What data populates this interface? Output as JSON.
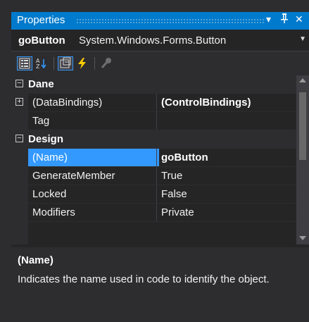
{
  "window": {
    "title": "Properties",
    "controls": {
      "dropdown": "▾",
      "pin": "ᵻ",
      "close": "✕"
    }
  },
  "object_selector": {
    "name": "goButton",
    "type": "System.Windows.Forms.Button"
  },
  "toolbar": {
    "buttons": [
      {
        "icon": "categorized-icon",
        "active": true
      },
      {
        "icon": "alphabetical-icon",
        "active": false
      },
      {
        "icon": "properties-icon",
        "active": true
      },
      {
        "icon": "events-icon",
        "active": false
      },
      {
        "icon": "property-pages-icon",
        "active": false
      }
    ]
  },
  "grid": {
    "categories": [
      {
        "name": "Dane",
        "expanded": true,
        "symbol": "−",
        "properties": [
          {
            "name": "(DataBindings)",
            "value": "(ControlBindings)",
            "expandable": true,
            "symbol": "+",
            "bold": true
          },
          {
            "name": "Tag",
            "value": ""
          }
        ]
      },
      {
        "name": "Design",
        "expanded": true,
        "symbol": "−",
        "properties": [
          {
            "name": "(Name)",
            "value": "goButton",
            "selected": true,
            "bold": true
          },
          {
            "name": "GenerateMember",
            "value": "True"
          },
          {
            "name": "Locked",
            "value": "False"
          },
          {
            "name": "Modifiers",
            "value": "Private"
          }
        ]
      }
    ]
  },
  "description": {
    "title": "(Name)",
    "text": "Indicates the name used in code to identify the object."
  },
  "colors": {
    "title_bar": "#007acc",
    "selection": "#3399ff",
    "background": "#252526",
    "events_icon": "#ffcc00"
  }
}
